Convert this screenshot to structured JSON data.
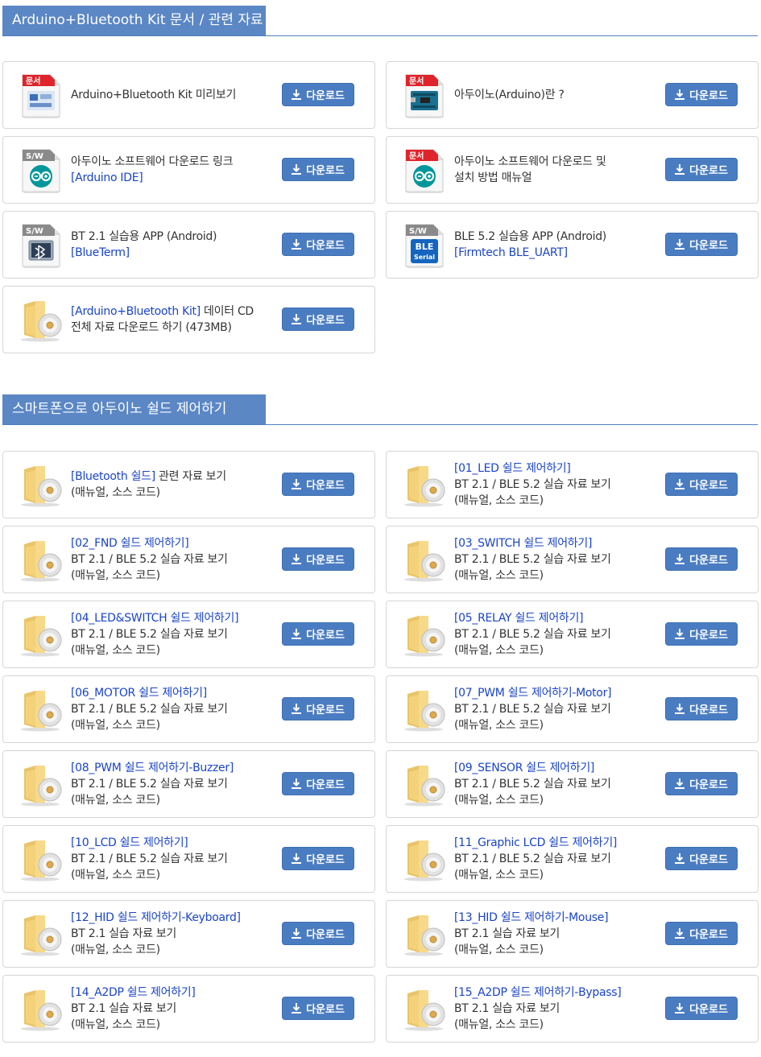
{
  "sections": [
    {
      "title": "Arduino+Bluetooth Kit 문서 / 관련 자료"
    },
    {
      "title": "스마트폰으로 아두이노 쉴드 제어하기"
    }
  ],
  "download_label": "다운로드",
  "badges": {
    "doc": "문서",
    "sw": "S/W",
    "ble_top": "BLE",
    "ble_bottom": "Serial"
  },
  "cards": [
    {
      "icon": "doc-preview",
      "lines": [
        {
          "t": "Arduino+Bluetooth Kit 미리보기"
        }
      ]
    },
    {
      "icon": "doc-arduino-board",
      "lines": [
        {
          "t": "아두이노(Arduino)란 ?"
        }
      ]
    },
    {
      "icon": "sw-arduino",
      "lines": [
        {
          "t": "아두이노 소프트웨어 다운로드 링크"
        },
        {
          "t": "[Arduino IDE]",
          "blue": true
        }
      ]
    },
    {
      "icon": "doc-arduino",
      "lines": [
        {
          "t": "아두이노 소프트웨어 다운로드 및"
        },
        {
          "t": "설치 방법 매뉴얼"
        }
      ]
    },
    {
      "icon": "sw-bluetooth",
      "lines": [
        {
          "t": "BT 2.1 실습용 APP (Android)"
        },
        {
          "t": "[BlueTerm]",
          "blue": true
        }
      ]
    },
    {
      "icon": "sw-ble",
      "lines": [
        {
          "t": "BLE 5.2 실습용 APP (Android)"
        },
        {
          "t": "[Firmtech BLE_UART]",
          "blue": true
        }
      ]
    },
    {
      "icon": "folder-cd",
      "lines": [
        {
          "b": "[Arduino+Bluetooth Kit]",
          "t": " 데이터 CD"
        },
        {
          "t": "전체 자료 다운로드 하기 (473MB)"
        }
      ]
    },
    {
      "icon": "folder-cd",
      "lines": [
        {
          "b": "[Bluetooth 쉴드]",
          "t": " 관련 자료 보기"
        },
        {
          "t": "(매뉴얼, 소스 코드)"
        }
      ]
    },
    {
      "icon": "folder-cd",
      "lines": [
        {
          "t": "[01_LED 쉴드 제어하기]",
          "blue": true
        },
        {
          "t": "BT 2.1 / BLE 5.2 실습 자료 보기"
        },
        {
          "t": "(매뉴얼, 소스 코드)"
        }
      ]
    },
    {
      "icon": "folder-cd",
      "lines": [
        {
          "t": "[02_FND 쉴드 제어하기]",
          "blue": true
        },
        {
          "t": "BT 2.1 / BLE 5.2 실습 자료 보기"
        },
        {
          "t": "(매뉴얼, 소스 코드)"
        }
      ]
    },
    {
      "icon": "folder-cd",
      "lines": [
        {
          "t": "[03_SWITCH 쉴드 제어하기]",
          "blue": true
        },
        {
          "t": "BT 2.1 / BLE 5.2 실습 자료 보기"
        },
        {
          "t": "(매뉴얼, 소스 코드)"
        }
      ]
    },
    {
      "icon": "folder-cd",
      "lines": [
        {
          "t": "[04_LED&SWITCH 쉴드 제어하기]",
          "blue": true
        },
        {
          "t": "BT 2.1 / BLE 5.2 실습 자료 보기"
        },
        {
          "t": "(매뉴얼, 소스 코드)"
        }
      ]
    },
    {
      "icon": "folder-cd",
      "lines": [
        {
          "t": "[05_RELAY 쉴드 제어하기]",
          "blue": true
        },
        {
          "t": "BT 2.1 / BLE 5.2 실습 자료 보기"
        },
        {
          "t": "(매뉴얼, 소스 코드)"
        }
      ]
    },
    {
      "icon": "folder-cd",
      "lines": [
        {
          "t": "[06_MOTOR 쉴드 제어하기]",
          "blue": true
        },
        {
          "t": "BT 2.1 / BLE 5.2 실습 자료 보기"
        },
        {
          "t": "(매뉴얼, 소스 코드)"
        }
      ]
    },
    {
      "icon": "folder-cd",
      "lines": [
        {
          "t": "[07_PWM 쉴드 제어하기-Motor]",
          "blue": true
        },
        {
          "t": "BT 2.1 / BLE 5.2 실습 자료 보기"
        },
        {
          "t": "(매뉴얼, 소스 코드)"
        }
      ]
    },
    {
      "icon": "folder-cd",
      "lines": [
        {
          "t": "[08_PWM 쉴드 제어하기-Buzzer]",
          "blue": true
        },
        {
          "t": "BT 2.1 / BLE 5.2 실습 자료 보기"
        },
        {
          "t": "(매뉴얼, 소스 코드)"
        }
      ]
    },
    {
      "icon": "folder-cd",
      "lines": [
        {
          "t": "[09_SENSOR 쉴드 제어하기]",
          "blue": true
        },
        {
          "t": "BT 2.1 / BLE 5.2 실습 자료 보기"
        },
        {
          "t": "(매뉴얼, 소스 코드)"
        }
      ]
    },
    {
      "icon": "folder-cd",
      "lines": [
        {
          "t": "[10_LCD 쉴드 제어하기]",
          "blue": true
        },
        {
          "t": "BT 2.1 / BLE 5.2 실습 자료 보기"
        },
        {
          "t": "(매뉴얼, 소스 코드)"
        }
      ]
    },
    {
      "icon": "folder-cd",
      "lines": [
        {
          "t": "[11_Graphic LCD 쉴드 제어하기]",
          "blue": true
        },
        {
          "t": "BT 2.1 / BLE 5.2 실습 자료 보기"
        },
        {
          "t": "(매뉴얼, 소스 코드)"
        }
      ]
    },
    {
      "icon": "folder-cd",
      "lines": [
        {
          "t": "[12_HID 쉴드 제어하기-Keyboard]",
          "blue": true
        },
        {
          "t": "BT 2.1 실습 자료 보기"
        },
        {
          "t": "(매뉴얼, 소스 코드)"
        }
      ]
    },
    {
      "icon": "folder-cd",
      "lines": [
        {
          "t": "[13_HID 쉴드 제어하기-Mouse]",
          "blue": true
        },
        {
          "t": "BT 2.1 실습 자료 보기"
        },
        {
          "t": "(매뉴얼, 소스 코드)"
        }
      ]
    },
    {
      "icon": "folder-cd",
      "lines": [
        {
          "t": "[14_A2DP 쉴드 제어하기]",
          "blue": true
        },
        {
          "t": "BT 2.1 실습 자료 보기"
        },
        {
          "t": "(매뉴얼, 소스 코드)"
        }
      ]
    },
    {
      "icon": "folder-cd",
      "lines": [
        {
          "t": "[15_A2DP 쉴드 제어하기-Bypass]",
          "blue": true
        },
        {
          "t": "BT 2.1 실습 자료 보기"
        },
        {
          "t": "(매뉴얼, 소스 코드)"
        }
      ]
    }
  ]
}
